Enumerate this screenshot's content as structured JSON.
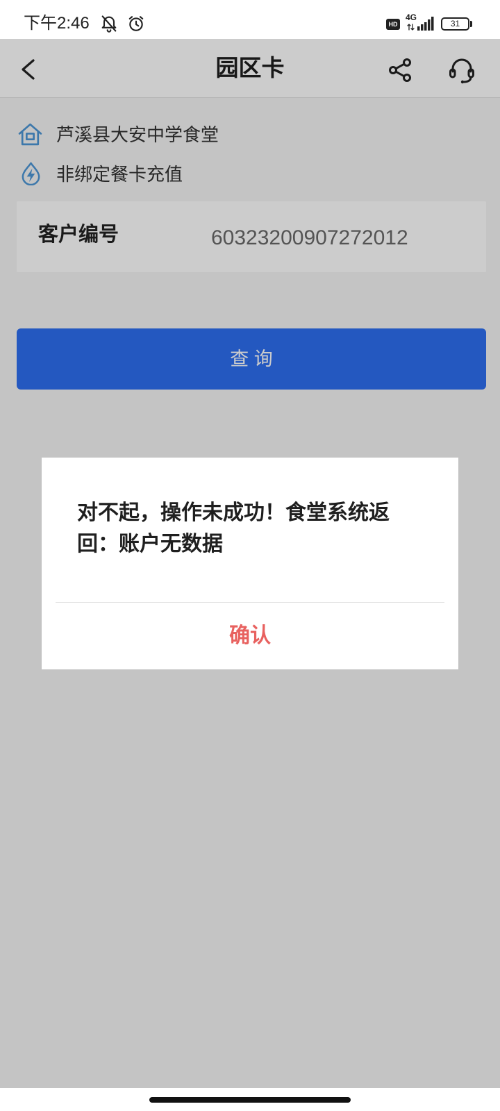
{
  "status_bar": {
    "time": "下午2:46",
    "hd_badge": "HD",
    "network": "4G",
    "battery": "31",
    "icons": [
      "mute-bell-icon",
      "alarm-clock-icon",
      "signal-icon",
      "battery-icon"
    ]
  },
  "header": {
    "title": "园区卡",
    "icons": {
      "back": "chevron-left-icon",
      "share": "share-icon",
      "support": "headset-icon"
    }
  },
  "info": {
    "merchant": {
      "icon": "house-icon",
      "text": "芦溪县大安中学食堂"
    },
    "service": {
      "icon": "bolt-drop-icon",
      "text": "非绑定餐卡充值"
    }
  },
  "customer": {
    "label": "客户编号",
    "number": "60323200907272012"
  },
  "query_button": {
    "label": "查 询"
  },
  "dialog": {
    "message": "对不起，操作未成功！食堂系统返回：账户无数据",
    "confirm_label": "确认"
  },
  "colors": {
    "primary": "#2d6ff0",
    "confirm": "#e8615f",
    "icon": "#4d97d6",
    "overlay": "rgba(0,0,0,0.2)"
  }
}
